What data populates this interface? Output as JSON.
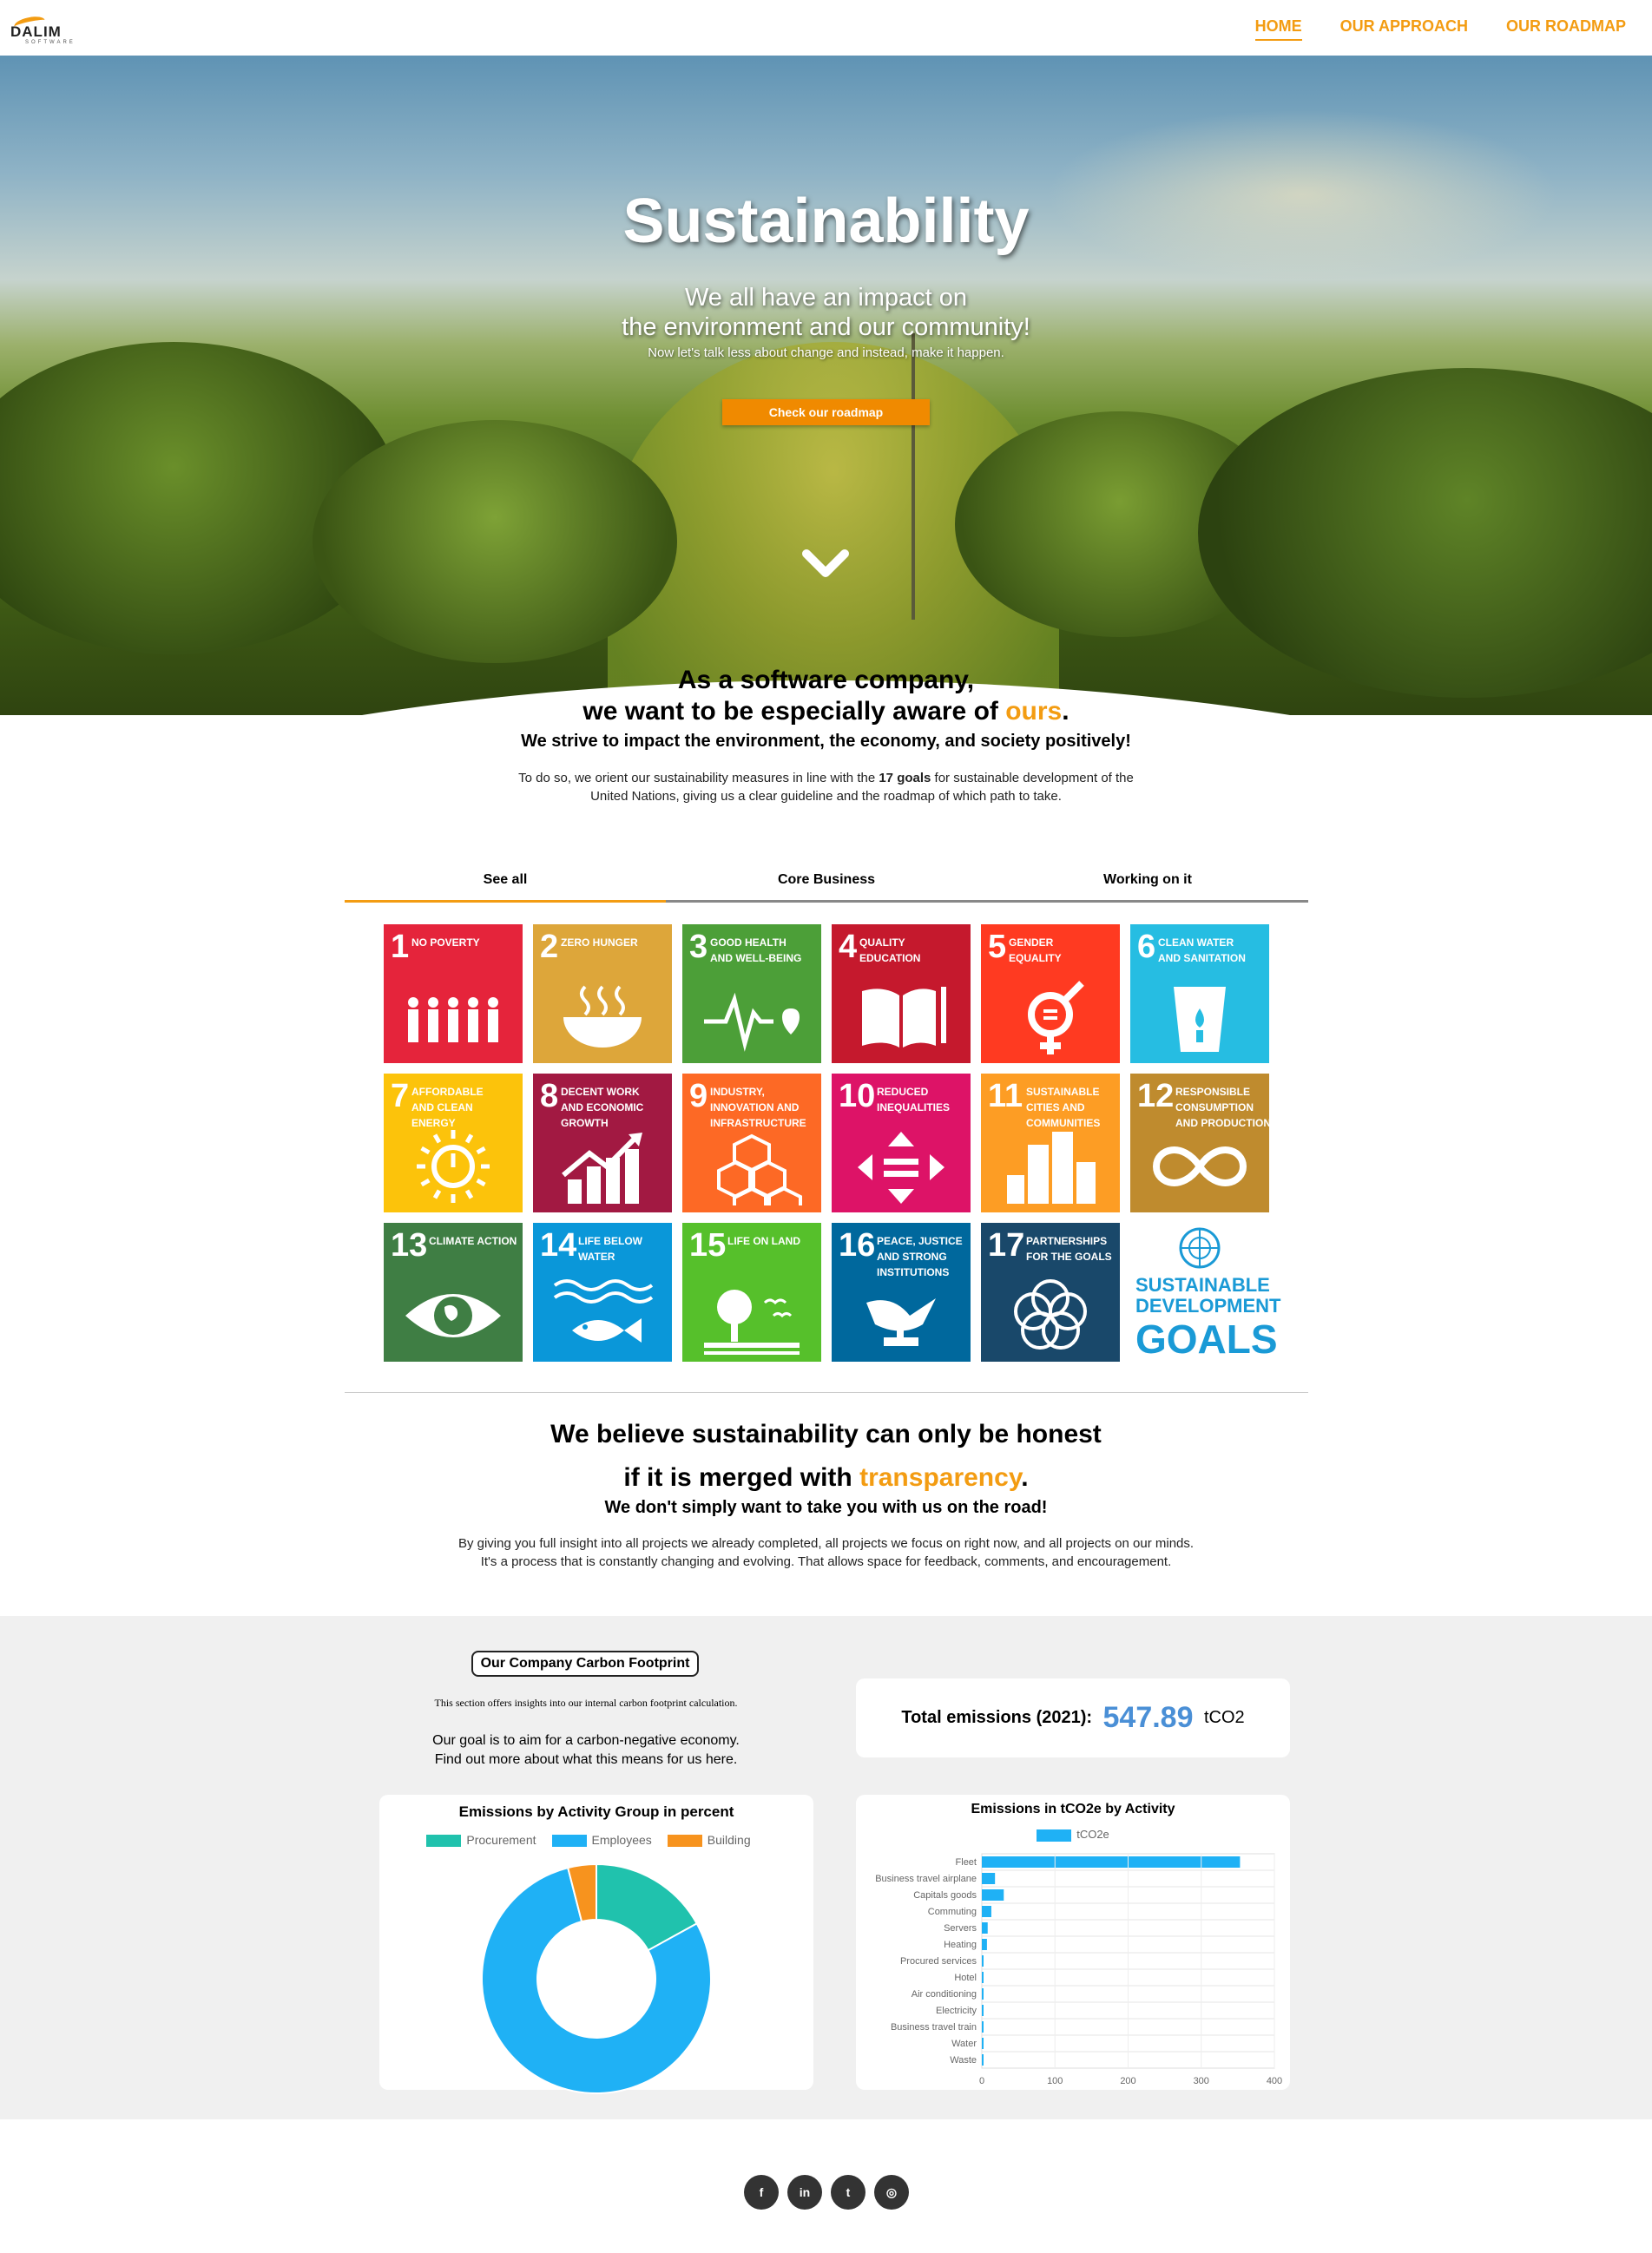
{
  "nav": {
    "logo_text": "DALIM",
    "logo_sub": "SOFTWARE",
    "links": [
      {
        "label": "HOME",
        "active": true
      },
      {
        "label": "OUR APPROACH",
        "active": false
      },
      {
        "label": "OUR ROADMAP",
        "active": false
      }
    ]
  },
  "hero": {
    "title": "Sustainability",
    "subtitle_line1": "We all have an impact on",
    "subtitle_line2": "the environment and our community!",
    "small": "Now let's talk less about change and instead, make it happen.",
    "button": "Check our roadmap",
    "scroll_icon": "chevron-down-icon"
  },
  "intro": {
    "line1": "As a software company,",
    "line2_prefix": "we want to be especially aware of ",
    "line2_highlight": "ours",
    "line2_suffix": ".",
    "tagline": "We strive to impact the environment, the economy, and society positively!",
    "body_prefix": "To do so, we orient our sustainability measures in line with the ",
    "body_bold": "17 goals",
    "body_suffix": " for sustainable development of the",
    "body_line2": "United Nations, giving us a clear guideline and the roadmap of which path to take."
  },
  "tabs": [
    {
      "label": "See all",
      "active": true
    },
    {
      "label": "Core Business",
      "active": false
    },
    {
      "label": "Working on it",
      "active": false
    }
  ],
  "sdgs": [
    {
      "num": "1",
      "label": "No Poverty",
      "color": "#e5243b",
      "icon": "people-icon"
    },
    {
      "num": "2",
      "label": "Zero Hunger",
      "color": "#dda63a",
      "icon": "bowl-icon"
    },
    {
      "num": "3",
      "label": "Good Health and Well-Being",
      "color": "#4c9f38",
      "icon": "heartbeat-icon"
    },
    {
      "num": "4",
      "label": "Quality Education",
      "color": "#c5192d",
      "icon": "book-icon"
    },
    {
      "num": "5",
      "label": "Gender Equality",
      "color": "#ff3a21",
      "icon": "gender-icon"
    },
    {
      "num": "6",
      "label": "Clean Water and Sanitation",
      "color": "#26bde2",
      "icon": "water-glass-icon"
    },
    {
      "num": "7",
      "label": "Affordable and Clean Energy",
      "color": "#fcc30b",
      "icon": "sun-power-icon"
    },
    {
      "num": "8",
      "label": "Decent Work and Economic Growth",
      "color": "#a21942",
      "icon": "growth-chart-icon"
    },
    {
      "num": "9",
      "label": "Industry, Innovation and Infrastructure",
      "color": "#fd6925",
      "icon": "cubes-icon"
    },
    {
      "num": "10",
      "label": "Reduced Inequalities",
      "color": "#dd1367",
      "icon": "arrows-equal-icon"
    },
    {
      "num": "11",
      "label": "Sustainable Cities and Communities",
      "color": "#fd9d24",
      "icon": "city-icon"
    },
    {
      "num": "12",
      "label": "Responsible Consumption and Production",
      "color": "#bf8b2e",
      "icon": "infinity-icon"
    },
    {
      "num": "13",
      "label": "Climate Action",
      "color": "#3f7e44",
      "icon": "eye-globe-icon"
    },
    {
      "num": "14",
      "label": "Life Below Water",
      "color": "#0a97d9",
      "icon": "fish-icon"
    },
    {
      "num": "15",
      "label": "Life on Land",
      "color": "#56c02b",
      "icon": "tree-birds-icon"
    },
    {
      "num": "16",
      "label": "Peace, Justice and Strong Institutions",
      "color": "#00689d",
      "icon": "dove-gavel-icon"
    },
    {
      "num": "17",
      "label": "Partnerships for the Goals",
      "color": "#19486a",
      "icon": "rings-icon"
    }
  ],
  "sdg_logo": {
    "line1": "SUSTAINABLE",
    "line2": "DEVELOPMENT",
    "line3": "GOALS"
  },
  "transparency": {
    "line1": "We believe sustainability can only be honest",
    "line2_prefix": "if it is merged with ",
    "line2_highlight": "transparency",
    "line2_suffix": ".",
    "tagline": "We don't simply want to take you with us on the road!",
    "body1": "By giving you full insight into all projects we already completed, all projects we focus on right now, and all projects on our minds.",
    "body2": "It's a process that is constantly changing and evolving. That allows space for feedback, comments, and encouragement."
  },
  "carbon": {
    "pill": "Our Company Carbon Footprint",
    "small": "This section offers insights into our internal carbon footprint calculation.",
    "goal1": "Our goal is to aim for a carbon-negative economy.",
    "goal2": "Find out more about what this means for us here.",
    "total_label": "Total emissions (2021):",
    "total_value": "547.89",
    "total_unit": "tCO2"
  },
  "chart_data": [
    {
      "type": "pie",
      "title": "Emissions by Activity Group in percent",
      "categories": [
        "Procurement",
        "Employees",
        "Building"
      ],
      "values": [
        17,
        79,
        4
      ],
      "colors": [
        "#20c2ad",
        "#1fb1f5",
        "#f7931e"
      ],
      "legend": "top",
      "donut": true
    },
    {
      "type": "bar",
      "orientation": "horizontal",
      "title": "Emissions in tCO2e by Activity",
      "series": [
        {
          "name": "tCO2e",
          "values": [
            353,
            18,
            30,
            13,
            8,
            7,
            2,
            1,
            1,
            1,
            0,
            0,
            0
          ]
        }
      ],
      "categories": [
        "Fleet",
        "Business travel airplane",
        "Capitals goods",
        "Commuting",
        "Servers",
        "Heating",
        "Procured services",
        "Hotel",
        "Air conditioning",
        "Electricity",
        "Business travel train",
        "Water",
        "Waste"
      ],
      "xlim": [
        0,
        400
      ],
      "xticks": [
        "0",
        "100",
        "200",
        "300",
        "400"
      ],
      "color": "#1fb1f5",
      "legend": "top",
      "grid": true
    }
  ],
  "social": [
    {
      "label": "f",
      "icon": "facebook-icon"
    },
    {
      "label": "in",
      "icon": "linkedin-icon"
    },
    {
      "label": "t",
      "icon": "twitter-icon"
    },
    {
      "label": "◎",
      "icon": "instagram-icon"
    }
  ]
}
